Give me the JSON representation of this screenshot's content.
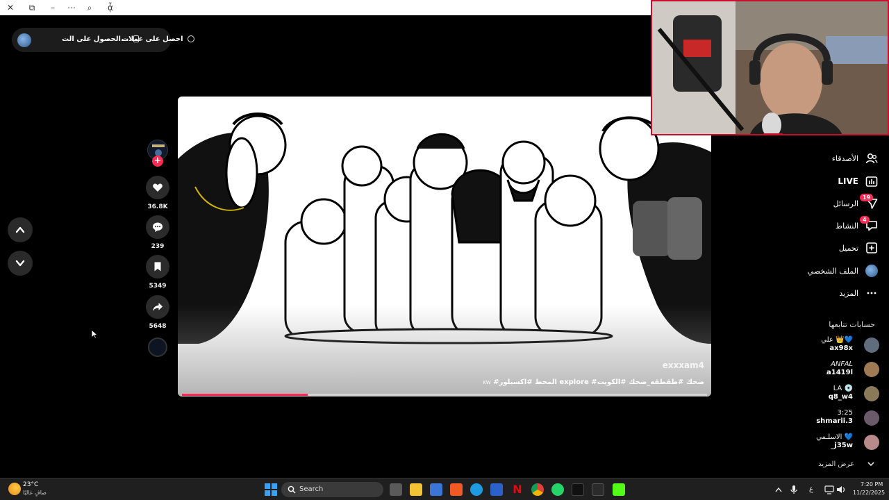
{
  "titlebar": {
    "icons": [
      "close-icon",
      "restore-icon",
      "minimize-icon",
      "more-icon",
      "zoom-icon",
      "translate-icon"
    ],
    "symbols": [
      "✕",
      "⧉",
      "–",
      "⋯",
      "⌕",
      "ᾆ"
    ]
  },
  "top_pill": {
    "option1": "الحصول على الت...",
    "option2": "احصل على عملات"
  },
  "actions": {
    "likes": "36.8K",
    "comments": "239",
    "saves": "5349",
    "shares": "5648"
  },
  "video": {
    "watermark": "exxxam4",
    "caption": "#المحط #اكسبلور explore #ضحك #طقطقه_ضحك #الكويت",
    "caption_suffix": "KW",
    "progress": 0.24
  },
  "sidebar": {
    "items": [
      {
        "label": "الأصدقاء",
        "icon": "friends-icon"
      },
      {
        "label": "LIVE",
        "icon": "live-icon"
      },
      {
        "label": "الرسائل",
        "icon": "messages-icon",
        "badge": "19"
      },
      {
        "label": "النشاط",
        "icon": "activity-icon",
        "badge": "4"
      },
      {
        "label": "تحميل",
        "icon": "upload-icon"
      },
      {
        "label": "الملف الشخصي",
        "icon": "profile-avatar"
      },
      {
        "label": "المزيد",
        "icon": "more-icon"
      }
    ],
    "following_title": "حسابات تتابعها",
    "following": [
      {
        "name": "علي 👑💙",
        "handle": "ax98x",
        "color": "#5f6d7d"
      },
      {
        "name": "ANFAL",
        "handle": "a1419l",
        "color": "#a07a55"
      },
      {
        "name": "LA 💿",
        "handle": "q8_w4",
        "color": "#8a7a5a"
      },
      {
        "name": "3:25",
        "handle": "shmarii.3",
        "color": "#6a5a6a"
      },
      {
        "name": "الاسلـمي 💙",
        "handle": "_j35w",
        "color": "#b88a8a"
      }
    ],
    "see_more": "عرض المزيد"
  },
  "taskbar": {
    "temp": "23°C",
    "condition": "صافٍ غالبًا",
    "search_placeholder": "Search",
    "lang": "ع",
    "time": "7:20 PM",
    "date": "11/22/2025"
  }
}
